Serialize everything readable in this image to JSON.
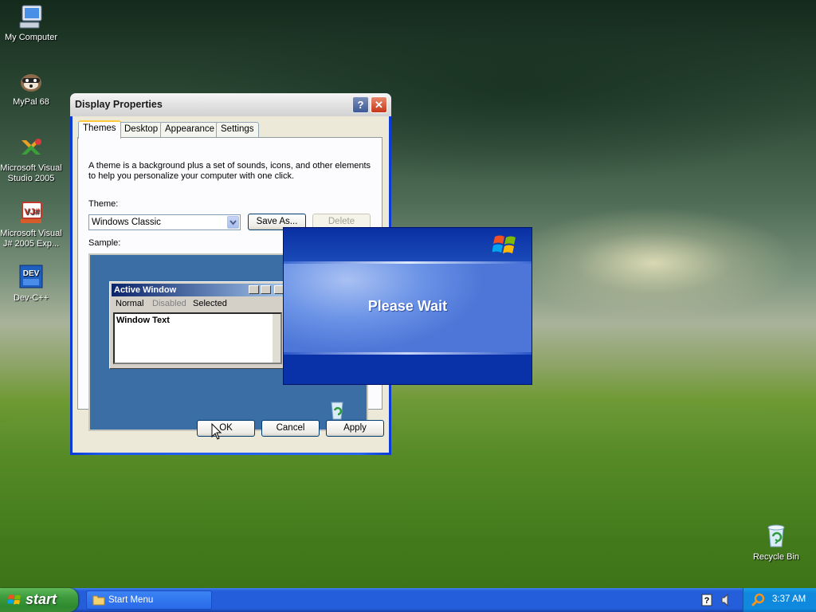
{
  "desktop": {
    "icons": [
      {
        "label": "My Computer",
        "icon": "computer-icon"
      },
      {
        "label": "MyPal 68",
        "icon": "mypal-browser-icon"
      },
      {
        "label": "Microsoft Visual Studio 2005",
        "icon": "visual-studio-icon"
      },
      {
        "label": "Microsoft Visual J# 2005 Exp...",
        "icon": "visual-jsharp-icon"
      },
      {
        "label": "Dev-C++",
        "icon": "dev-cpp-icon"
      },
      {
        "label": "Recycle Bin",
        "icon": "recycle-bin-icon"
      }
    ]
  },
  "display_properties": {
    "title": "Display Properties",
    "tabs": [
      "Themes",
      "Desktop",
      "Appearance",
      "Settings"
    ],
    "active_tab": "Themes",
    "description": "A theme is a background plus a set of sounds, icons, and other elements to help you personalize your computer with one click.",
    "theme_label": "Theme:",
    "theme_value": "Windows Classic",
    "save_as_label": "Save As...",
    "delete_label": "Delete",
    "sample_label": "Sample:",
    "sample": {
      "window_title": "Active Window",
      "menu": [
        "Normal",
        "Disabled",
        "Selected"
      ],
      "window_text": "Window Text"
    },
    "ok_label": "OK",
    "cancel_label": "Cancel",
    "apply_label": "Apply"
  },
  "splash": {
    "message": "Please Wait"
  },
  "taskbar": {
    "start_label": "start",
    "tasks": [
      "Start Menu"
    ],
    "clock": "3:37 AM"
  },
  "colors": {
    "xp_blue": "#245edb",
    "start_green": "#3c9a3c",
    "classic_desktop": "#3a6ea5"
  }
}
